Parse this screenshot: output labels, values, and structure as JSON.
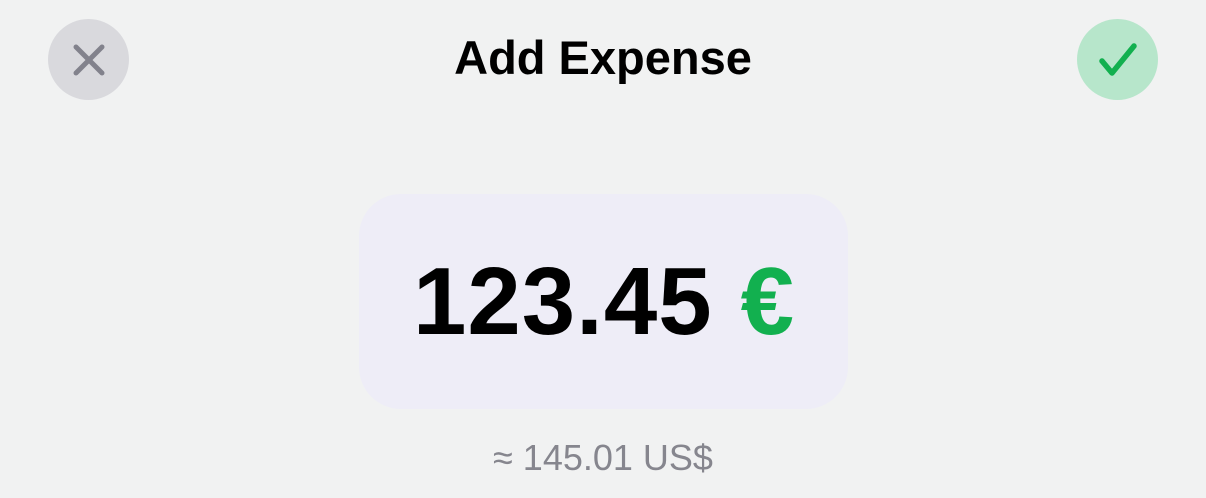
{
  "header": {
    "title": "Add Expense",
    "close_icon": "close-icon",
    "confirm_icon": "checkmark-icon"
  },
  "amount": {
    "value": "123.45",
    "currency_symbol": "€"
  },
  "conversion": {
    "text": "≈ 145.01 US$"
  },
  "colors": {
    "background": "#f1f2f2",
    "close_button_bg": "#d9d9dd",
    "close_icon": "#82828c",
    "confirm_button_bg": "#b7e6cb",
    "accent_green": "#12b04f",
    "amount_card_bg": "#eeedf7",
    "secondary_text": "#86868e"
  }
}
